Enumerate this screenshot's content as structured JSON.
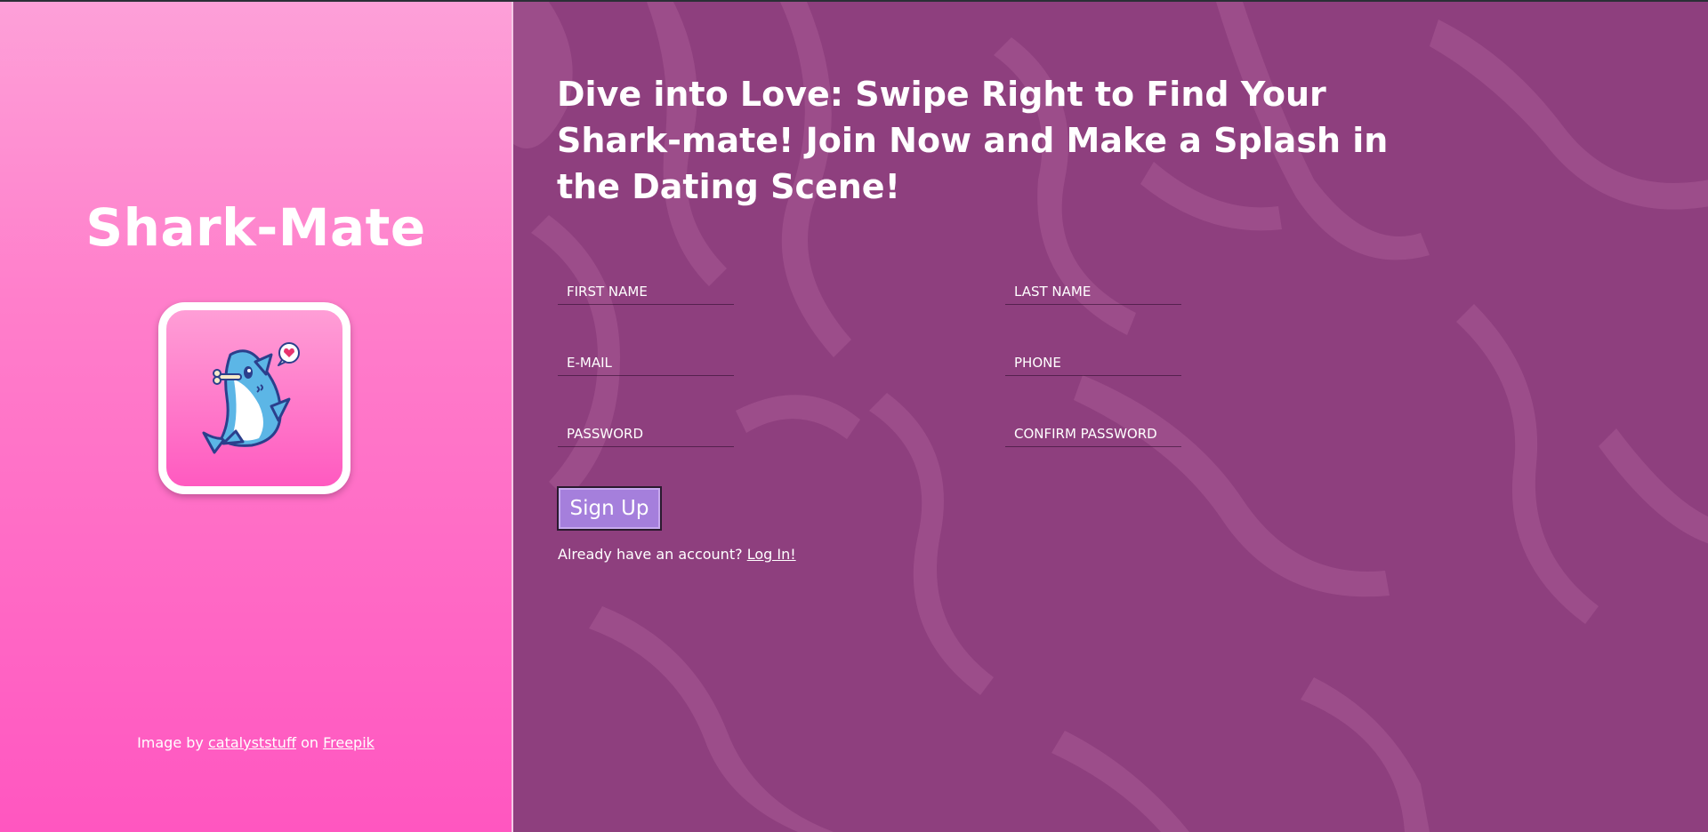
{
  "left": {
    "brand_title": "Shark-Mate",
    "attribution": {
      "prefix": "Image by",
      "author_link": "catalyststuff",
      "middle": "on",
      "source_link": "Freepik"
    }
  },
  "right": {
    "headline": "Dive into Love: Swipe Right to Find Your Shark-mate! Join Now and Make a Splash in the Dating Scene!",
    "form": {
      "first_name_placeholder": "First Name",
      "last_name_placeholder": "Last Name",
      "email_placeholder": "E-mail",
      "phone_placeholder": "Phone",
      "password_placeholder": "Password",
      "confirm_password_placeholder": "Confirm Password",
      "submit_label": "Sign Up"
    },
    "login_prompt": "Already have an account?",
    "login_link": "Log In!"
  },
  "colors": {
    "left_gradient_top": "#fda0d8",
    "left_gradient_bottom": "#ff56c0",
    "right_background": "#8e3f7e",
    "button": "#a57fdc"
  },
  "icons": {
    "logo": "shark-with-heart-icon"
  }
}
